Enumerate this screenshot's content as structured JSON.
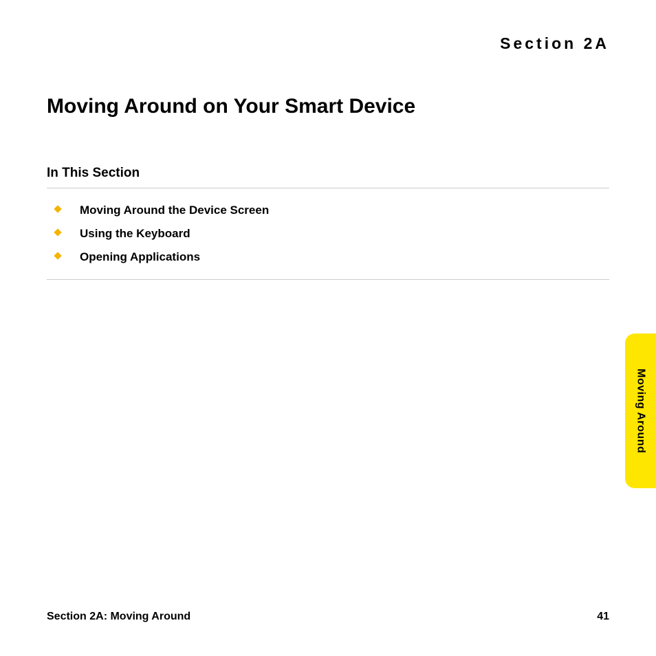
{
  "header": {
    "section_label": "Section 2A"
  },
  "title": "Moving Around on Your Smart Device",
  "subsection": {
    "heading": "In This Section",
    "items": [
      "Moving Around the Device Screen",
      "Using the Keyboard",
      "Opening Applications"
    ]
  },
  "side_tab": {
    "label": "Moving Around"
  },
  "footer": {
    "section_ref": "Section 2A: Moving Around",
    "page_number": "41"
  }
}
